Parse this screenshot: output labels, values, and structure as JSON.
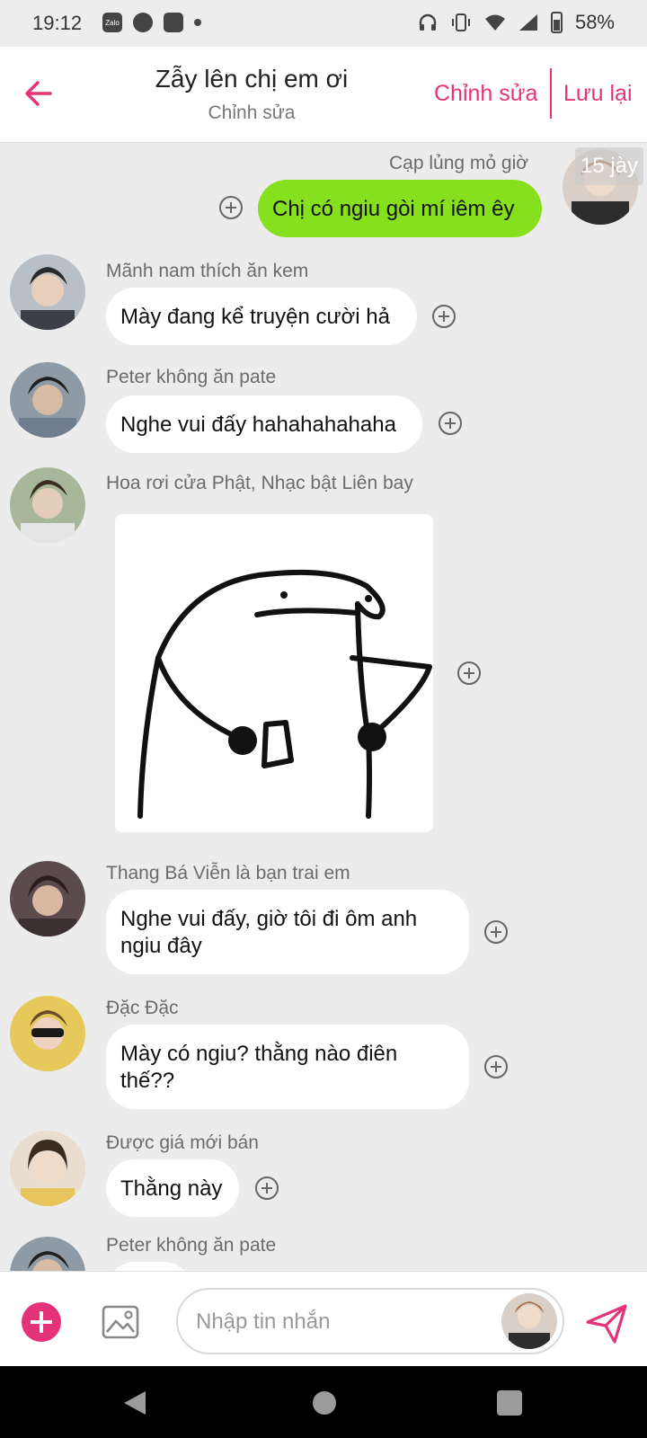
{
  "status_bar": {
    "time": "19:12",
    "battery": "58%"
  },
  "header": {
    "title": "Zẫy lên chị em ơi",
    "subtitle": "Chỉnh sửa",
    "edit_label": "Chỉnh sửa",
    "save_label": "Lưu lại"
  },
  "chat": {
    "time_badge": "15 jày",
    "messages": [
      {
        "sender": "Cạp lủng mỏ giờ",
        "text": "Chị có ngiu gòi mí iêm êy",
        "me": true
      },
      {
        "sender": "Mãnh nam thích ăn kem",
        "text": "Mày đang kể truyện cười hả"
      },
      {
        "sender": "Peter không ăn pate",
        "text": "Nghe vui đấy hahahahahaha"
      },
      {
        "sender": "Hoa rơi cửa Phật, Nhạc bật Liên bay",
        "sticker": "blob-sticker"
      },
      {
        "sender": "Thang Bá Viễn là bạn trai em",
        "text": "Nghe vui đấy, giờ tôi đi ôm anh ngiu đây"
      },
      {
        "sender": "Đặc Đặc",
        "text": "Mày có ngiu? thằng nào điên thế??"
      },
      {
        "sender": "Được giá mới bán",
        "text": "Thằng này"
      },
      {
        "sender": "Peter không ăn pate"
      }
    ]
  },
  "composer": {
    "placeholder": "Nhập tin nhắn"
  },
  "colors": {
    "accent": "#e5337a",
    "my_bubble": "#86e01d",
    "background": "#ececec"
  }
}
